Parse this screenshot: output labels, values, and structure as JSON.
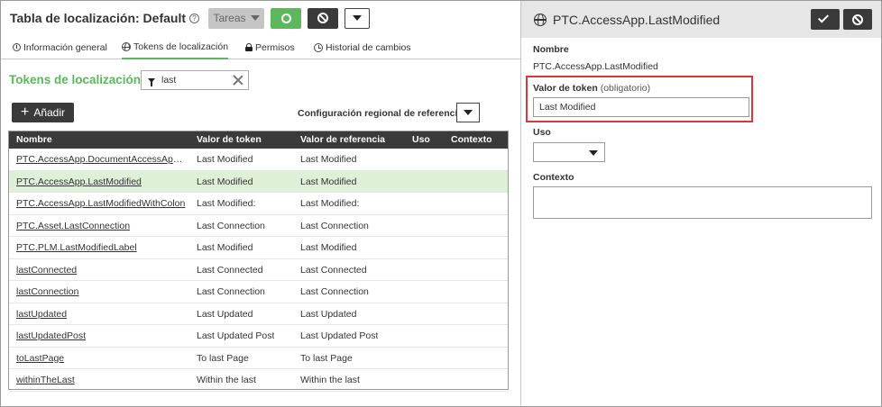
{
  "header": {
    "title": "Tabla de localización: Default",
    "help_glyph": "?",
    "tasks_label": "Tareas"
  },
  "tabs": [
    {
      "label": "Información general"
    },
    {
      "label": "Tokens de localización",
      "active": true
    },
    {
      "label": "Permisos"
    },
    {
      "label": "Historial de cambios"
    }
  ],
  "section": {
    "title": "Tokens de localización",
    "filter_value": "last",
    "add_label": "Añadir",
    "ref_config_label": "Configuración regional de referencia"
  },
  "grid": {
    "columns": [
      "Nombre",
      "Valor de token",
      "Valor de referencia",
      "Uso",
      "Contexto"
    ],
    "rows": [
      {
        "name": "PTC.AccessApp.DocumentAccessApp.A...",
        "token": "Last Modified",
        "ref": "Last Modified",
        "selected": false
      },
      {
        "name": "PTC.AccessApp.LastModified",
        "token": "Last Modified",
        "ref": "Last Modified",
        "selected": true
      },
      {
        "name": "PTC.AccessApp.LastModifiedWithColon",
        "token": "Last Modified:",
        "ref": "Last Modified:",
        "selected": false
      },
      {
        "name": "PTC.Asset.LastConnection",
        "token": "Last Connection",
        "ref": "Last Connection",
        "selected": false
      },
      {
        "name": "PTC.PLM.LastModifiedLabel",
        "token": "Last Modified",
        "ref": "Last Modified",
        "selected": false
      },
      {
        "name": "lastConnected",
        "token": "Last Connected",
        "ref": "Last Connected",
        "selected": false
      },
      {
        "name": "lastConnection",
        "token": "Last Connection",
        "ref": "Last Connection",
        "selected": false
      },
      {
        "name": "lastUpdated",
        "token": "Last Updated",
        "ref": "Last Updated",
        "selected": false
      },
      {
        "name": "lastUpdatedPost",
        "token": "Last Updated Post",
        "ref": "Last Updated Post",
        "selected": false
      },
      {
        "name": "toLastPage",
        "token": "To last Page",
        "ref": "To last Page",
        "selected": false
      },
      {
        "name": "withinTheLast",
        "token": "Within the last",
        "ref": "Within the last",
        "selected": false
      }
    ]
  },
  "detail": {
    "title": "PTC.AccessApp.LastModified",
    "name_label": "Nombre",
    "name_value": "PTC.AccessApp.LastModified",
    "token_label": "Valor de token",
    "token_required": "(obligatorio)",
    "token_value": "Last Modified",
    "uso_label": "Uso",
    "context_label": "Contexto"
  },
  "colors": {
    "accent_green": "#5cb85c",
    "dark_button": "#3a3a3a",
    "selected_row": "#dff0d8",
    "highlight_red": "#d9383a"
  }
}
